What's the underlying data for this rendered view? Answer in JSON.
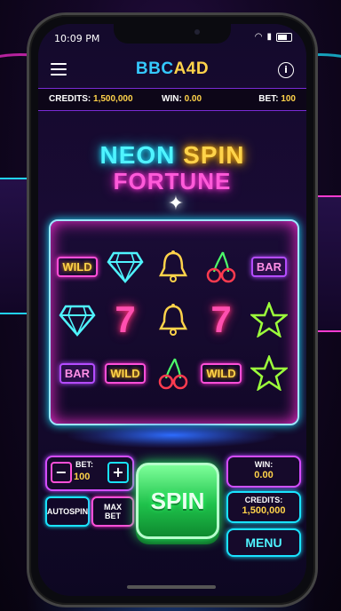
{
  "status": {
    "time": "10:09 PM"
  },
  "app": {
    "logo_part1": "BBC",
    "logo_part2": "A4D"
  },
  "info": {
    "credits_label": "CREDITS:",
    "credits_value": "1,500,000",
    "win_label": "WIN:",
    "win_value": "0.00",
    "bet_label": "BET:",
    "bet_value": "100"
  },
  "title": {
    "word1": "NEON",
    "word2": "SPIN",
    "line2": "FORTUNE"
  },
  "reels": [
    [
      "WILD",
      "diamond",
      "BAR"
    ],
    [
      "diamond",
      "7",
      "WILD"
    ],
    [
      "bell",
      "bell",
      "cherry"
    ],
    [
      "cherry",
      "7",
      "WILD"
    ],
    [
      "BAR",
      "star",
      "star"
    ]
  ],
  "controls": {
    "bet_label": "BET:",
    "bet_value": "100",
    "minus": "−",
    "plus": "+",
    "autospin": "AUTOSPIN",
    "maxbet_line1": "MAX",
    "maxbet_line2": "BET",
    "spin": "SPIN",
    "win_label": "WIN:",
    "win_value": "0.00",
    "credits_label": "CREDITS:",
    "credits_value": "1,500,000",
    "menu": "MENU"
  },
  "colors": {
    "accent_cyan": "#19e3ff",
    "accent_pink": "#ff2fd6",
    "accent_gold": "#ffd34a",
    "spin_green": "#1fc24b"
  }
}
